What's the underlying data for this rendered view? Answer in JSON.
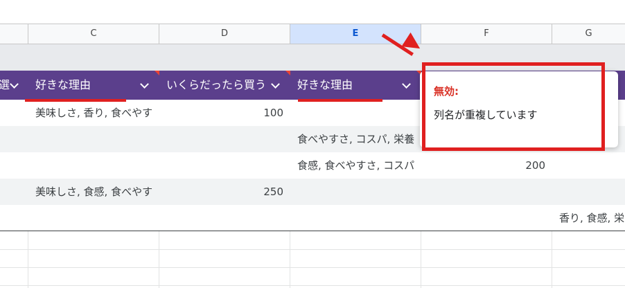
{
  "columns": [
    "C",
    "D",
    "E",
    "F",
    "G"
  ],
  "selected_column": "E",
  "table_header": {
    "partial_left": "選",
    "col_c": "好きな理由",
    "col_d": "いくらだったら買う",
    "col_e": "好きな理由"
  },
  "rows": [
    {
      "c": "美味しさ, 香り, 食べやす",
      "d": "100",
      "e": "",
      "f": "",
      "g": ""
    },
    {
      "c": "",
      "d": "",
      "e": "食べやすさ, コスパ, 栄養",
      "f": "",
      "g": ""
    },
    {
      "c": "",
      "d": "",
      "e": "食感, 食べやすさ, コスパ",
      "f": "200",
      "g": ""
    },
    {
      "c": "美味しさ, 食感, 食べやす",
      "d": "250",
      "e": "",
      "f": "",
      "g": ""
    },
    {
      "c": "",
      "d": "",
      "e": "",
      "f": "",
      "g": "香り, 食感, 栄"
    }
  ],
  "tooltip": {
    "title": "無効:",
    "message": "列名が重複しています"
  },
  "colors": {
    "header_purple": "#5b3f8c",
    "annotation_red": "#e02020",
    "error_red": "#d93025",
    "selected_col_bg": "#d3e3fd"
  },
  "icons": [
    "dropdown-chevron-icon",
    "annotation-arrow",
    "note-triangle-icon"
  ]
}
